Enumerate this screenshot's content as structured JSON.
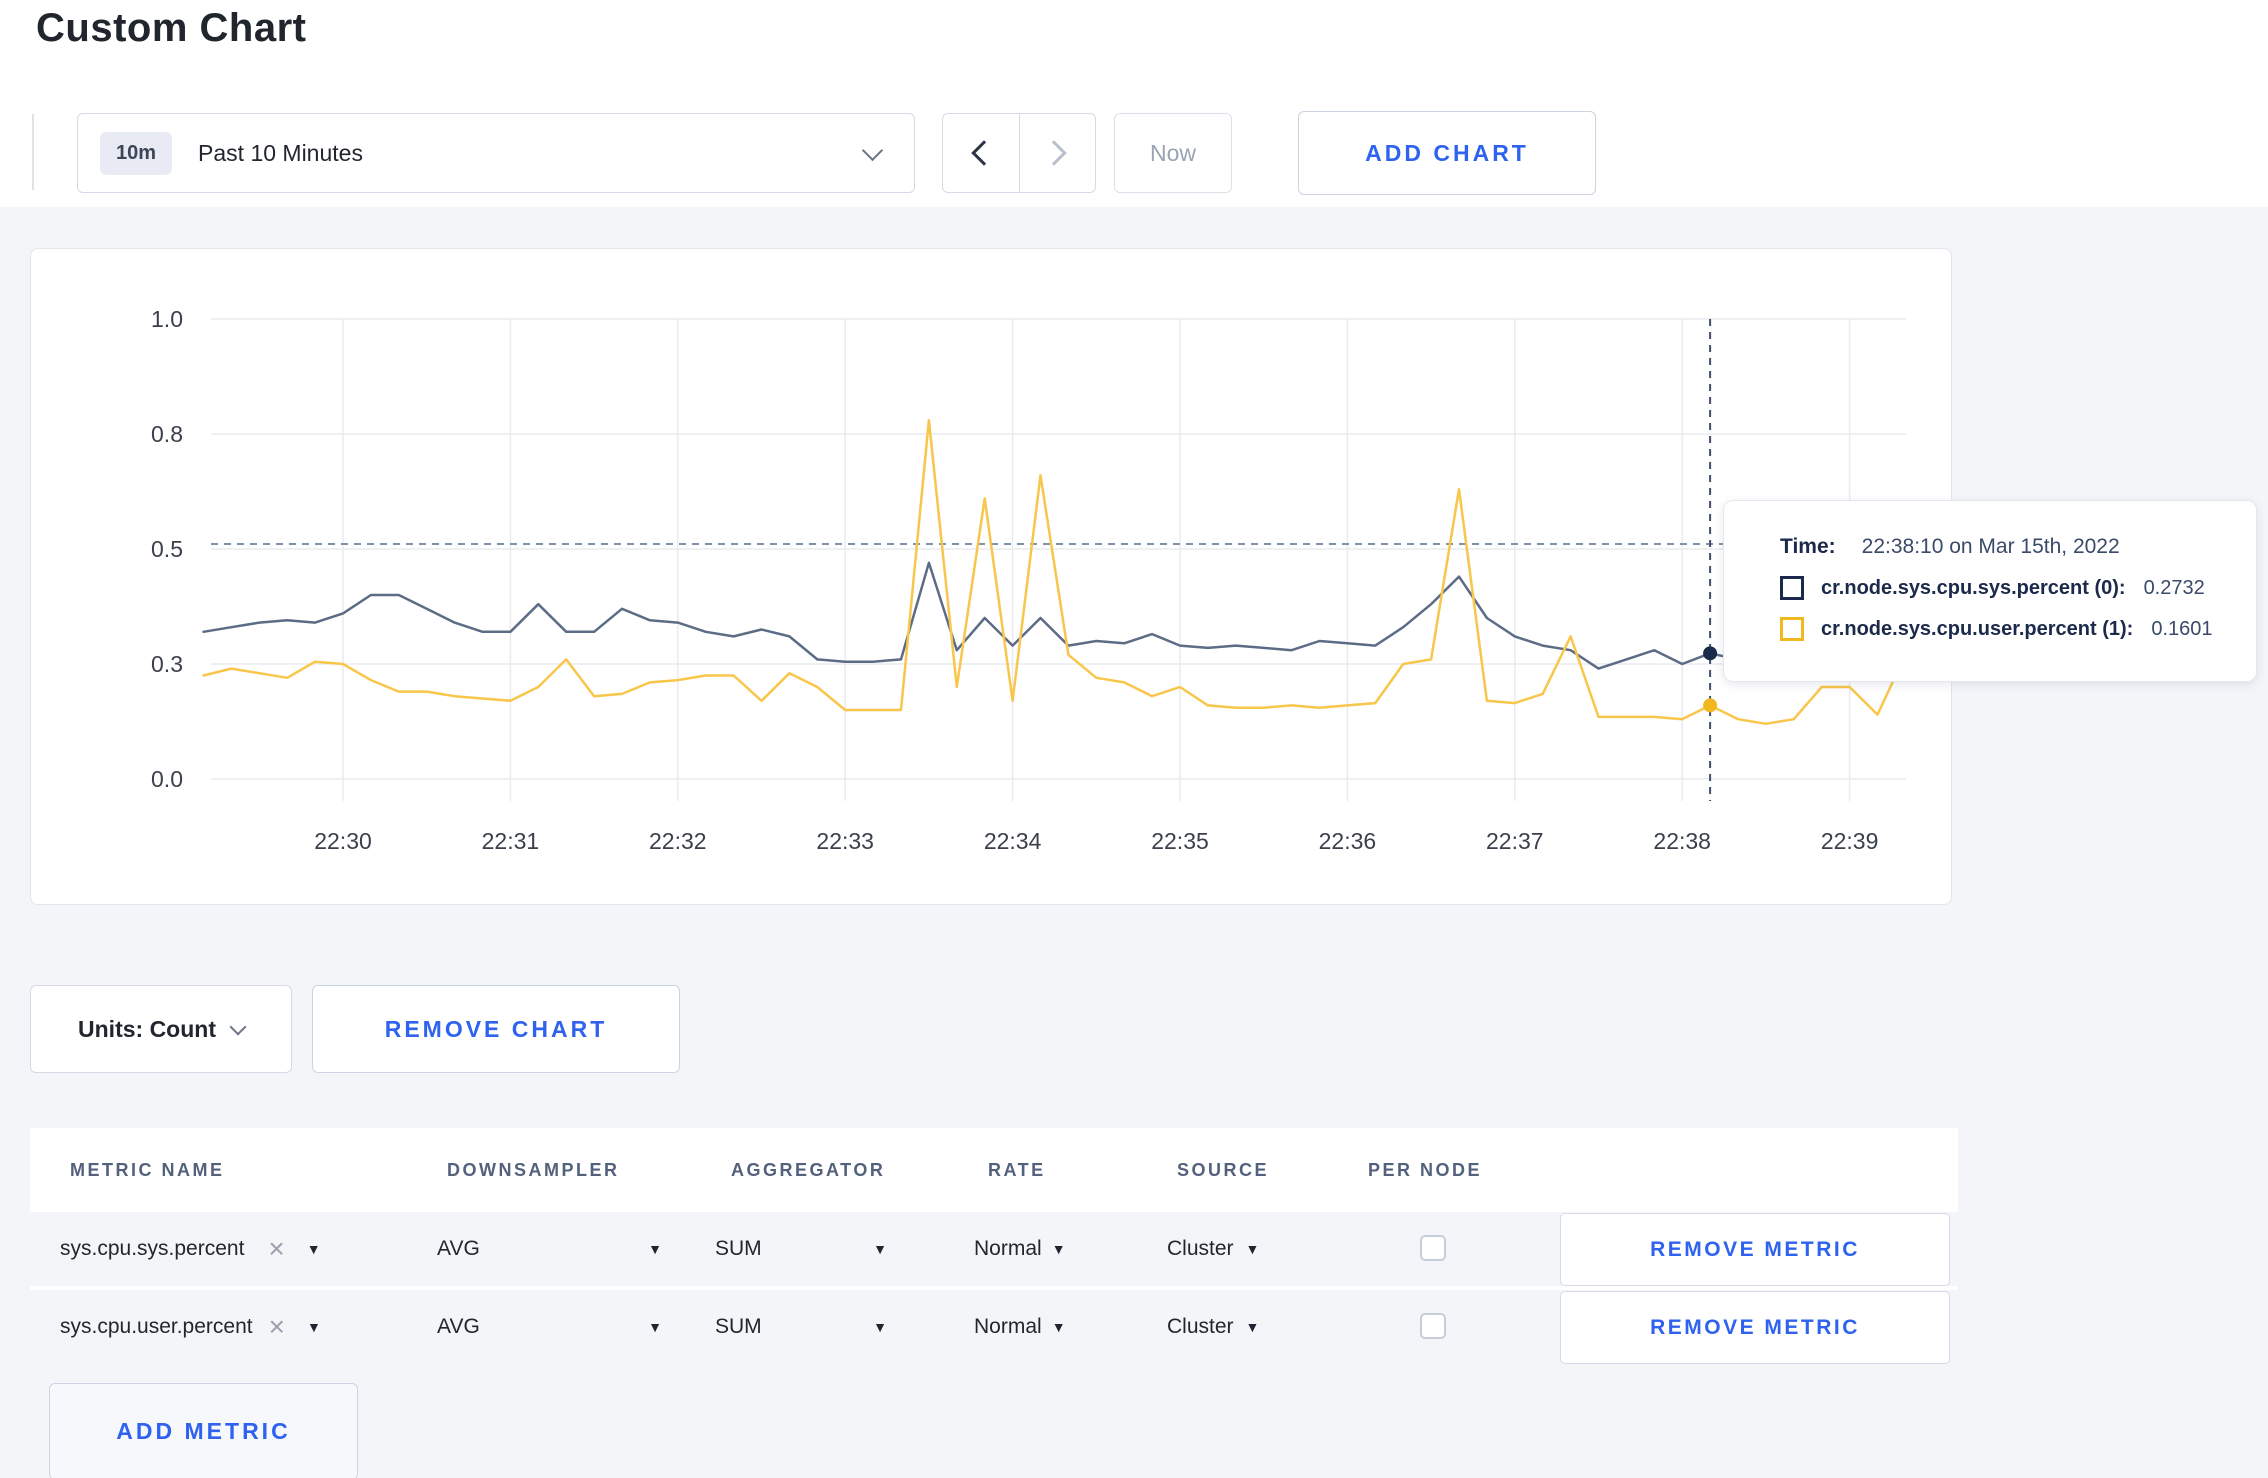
{
  "page": {
    "title": "Custom Chart"
  },
  "toolbar": {
    "time_range": {
      "badge": "10m",
      "label": "Past 10 Minutes"
    },
    "now_label": "Now",
    "add_chart_label": "ADD CHART"
  },
  "chart_data": {
    "type": "line",
    "title": "",
    "ylim": [
      0,
      1
    ],
    "grid": true,
    "yaxis": {
      "tick_values": [
        0,
        0.25,
        0.5,
        0.75,
        1.0
      ],
      "tick_labels": [
        "0.0",
        "0.3",
        "0.5",
        "0.8",
        "1.0"
      ]
    },
    "xaxis": {
      "labels": [
        "22:30",
        "22:31",
        "22:32",
        "22:33",
        "22:34",
        "22:35",
        "22:36",
        "22:37",
        "22:38",
        "22:39"
      ]
    },
    "hover_value_line": 0.511,
    "start_offset_min": -0.8333,
    "step_sec": 10,
    "series": [
      {
        "name": "cr.node.sys.cpu.sys.percent",
        "color": "#5d6c86",
        "values": [
          0.32,
          0.33,
          0.34,
          0.345,
          0.34,
          0.36,
          0.4,
          0.4,
          0.37,
          0.34,
          0.32,
          0.32,
          0.38,
          0.32,
          0.32,
          0.37,
          0.345,
          0.34,
          0.32,
          0.31,
          0.325,
          0.31,
          0.26,
          0.255,
          0.255,
          0.26,
          0.47,
          0.28,
          0.35,
          0.29,
          0.35,
          0.29,
          0.3,
          0.295,
          0.315,
          0.29,
          0.285,
          0.29,
          0.285,
          0.28,
          0.3,
          0.295,
          0.29,
          0.33,
          0.38,
          0.44,
          0.35,
          0.31,
          0.29,
          0.28,
          0.24,
          0.26,
          0.28,
          0.25,
          0.2732,
          0.26,
          0.27,
          0.27,
          0.28,
          0.28,
          0.28,
          0.29
        ]
      },
      {
        "name": "cr.node.sys.cpu.user.percent",
        "color": "#f8c64a",
        "values": [
          0.225,
          0.24,
          0.23,
          0.22,
          0.255,
          0.25,
          0.215,
          0.19,
          0.19,
          0.18,
          0.175,
          0.17,
          0.2,
          0.26,
          0.18,
          0.185,
          0.21,
          0.215,
          0.225,
          0.225,
          0.17,
          0.23,
          0.2,
          0.15,
          0.15,
          0.15,
          0.78,
          0.2,
          0.61,
          0.17,
          0.66,
          0.27,
          0.22,
          0.21,
          0.18,
          0.2,
          0.16,
          0.155,
          0.155,
          0.16,
          0.155,
          0.16,
          0.165,
          0.25,
          0.26,
          0.63,
          0.17,
          0.165,
          0.185,
          0.31,
          0.135,
          0.135,
          0.135,
          0.13,
          0.1601,
          0.13,
          0.12,
          0.13,
          0.2,
          0.2,
          0.14,
          0.27
        ]
      }
    ],
    "crosshair": {
      "minutes_after_first_label": 8.1667,
      "color": "#3f4f68"
    },
    "tooltip": {
      "time_label": "Time:",
      "time_value": "22:38:10 on Mar 15th, 2022",
      "rows": [
        {
          "label": "cr.node.sys.cpu.sys.percent (0):",
          "value": "0.2732",
          "color": "#1b2a4a"
        },
        {
          "label": "cr.node.sys.cpu.user.percent (1):",
          "value": "0.1601",
          "color": "#f2b71e"
        }
      ]
    }
  },
  "chart_footer": {
    "units_label": "Units: Count",
    "remove_chart_label": "REMOVE CHART"
  },
  "metrics_table": {
    "headers": [
      "METRIC NAME",
      "DOWNSAMPLER",
      "AGGREGATOR",
      "RATE",
      "SOURCE",
      "PER NODE"
    ],
    "rows": [
      {
        "metric": "sys.cpu.sys.percent",
        "downsampler": "AVG",
        "aggregator": "SUM",
        "rate": "Normal",
        "source": "Cluster",
        "per_node_checked": false,
        "remove_label": "REMOVE METRIC"
      },
      {
        "metric": "sys.cpu.user.percent",
        "downsampler": "AVG",
        "aggregator": "SUM",
        "rate": "Normal",
        "source": "Cluster",
        "per_node_checked": false,
        "remove_label": "REMOVE METRIC"
      }
    ],
    "add_metric_label": "ADD METRIC"
  }
}
